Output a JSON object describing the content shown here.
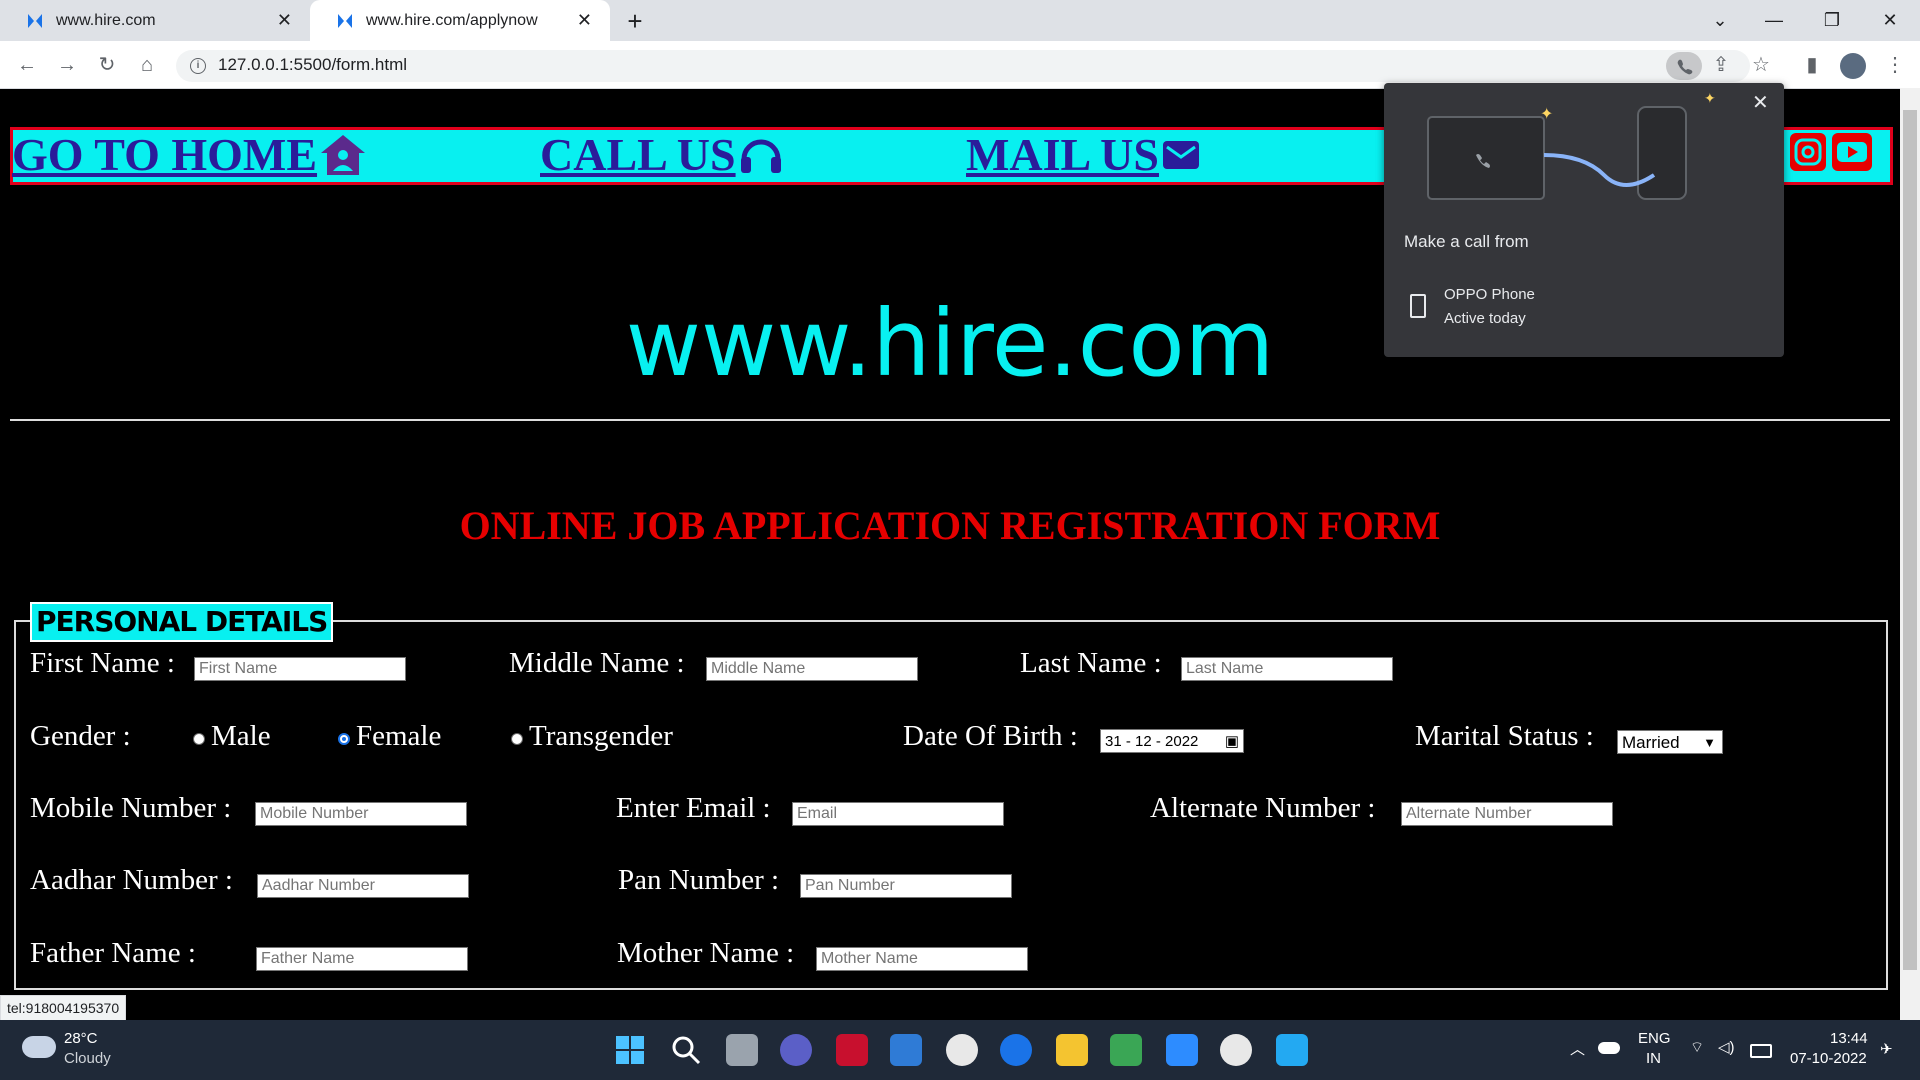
{
  "browser": {
    "tabs": [
      {
        "title": "www.hire.com",
        "active": false
      },
      {
        "title": "www.hire.com/applynow",
        "active": true
      }
    ],
    "url": "127.0.0.1:5500/form.html",
    "status_url": "tel:918004195370"
  },
  "nav": {
    "home": "GO TO HOME",
    "call": "CALL US",
    "mail": "MAIL US"
  },
  "site_name": "www.hire.com",
  "form_title": "ONLINE JOB APPLICATION REGISTRATION FORM",
  "section_title": "PERSONAL DETAILS",
  "fields": {
    "first_name": {
      "label": "First Name :",
      "placeholder": "First Name"
    },
    "middle_name": {
      "label": "Middle Name :",
      "placeholder": "Middle Name"
    },
    "last_name": {
      "label": "Last Name :",
      "placeholder": "Last Name"
    },
    "gender": {
      "label": "Gender :",
      "options": [
        "Male",
        "Female",
        "Transgender"
      ],
      "selected": "Female"
    },
    "dob": {
      "label": "Date Of Birth :",
      "value": "31 - 12 - 2022"
    },
    "marital": {
      "label": "Marital Status :",
      "value": "Married"
    },
    "mobile": {
      "label": "Mobile Number :",
      "placeholder": "Mobile Number"
    },
    "email": {
      "label": "Enter Email :",
      "placeholder": "Email"
    },
    "alternate": {
      "label": "Alternate Number :",
      "placeholder": "Alternate Number"
    },
    "aadhar": {
      "label": "Aadhar Number :",
      "placeholder": "Aadhar Number"
    },
    "pan": {
      "label": "Pan Number :",
      "placeholder": "Pan Number"
    },
    "father": {
      "label": "Father Name :",
      "placeholder": "Father Name"
    },
    "mother": {
      "label": "Mother Name :",
      "placeholder": "Mother Name"
    }
  },
  "call_popup": {
    "title": "Make a call from",
    "device": "OPPO Phone",
    "status": "Active today"
  },
  "taskbar": {
    "weather_temp": "28°C",
    "weather_desc": "Cloudy",
    "lang_line1": "ENG",
    "lang_line2": "IN",
    "time": "13:44",
    "date": "07-10-2022"
  },
  "colors": {
    "accent_cyan": "#08f0f0",
    "nav_border": "#e0001b",
    "title_red": "#e60000",
    "link_blue": "#2a1c9a"
  }
}
